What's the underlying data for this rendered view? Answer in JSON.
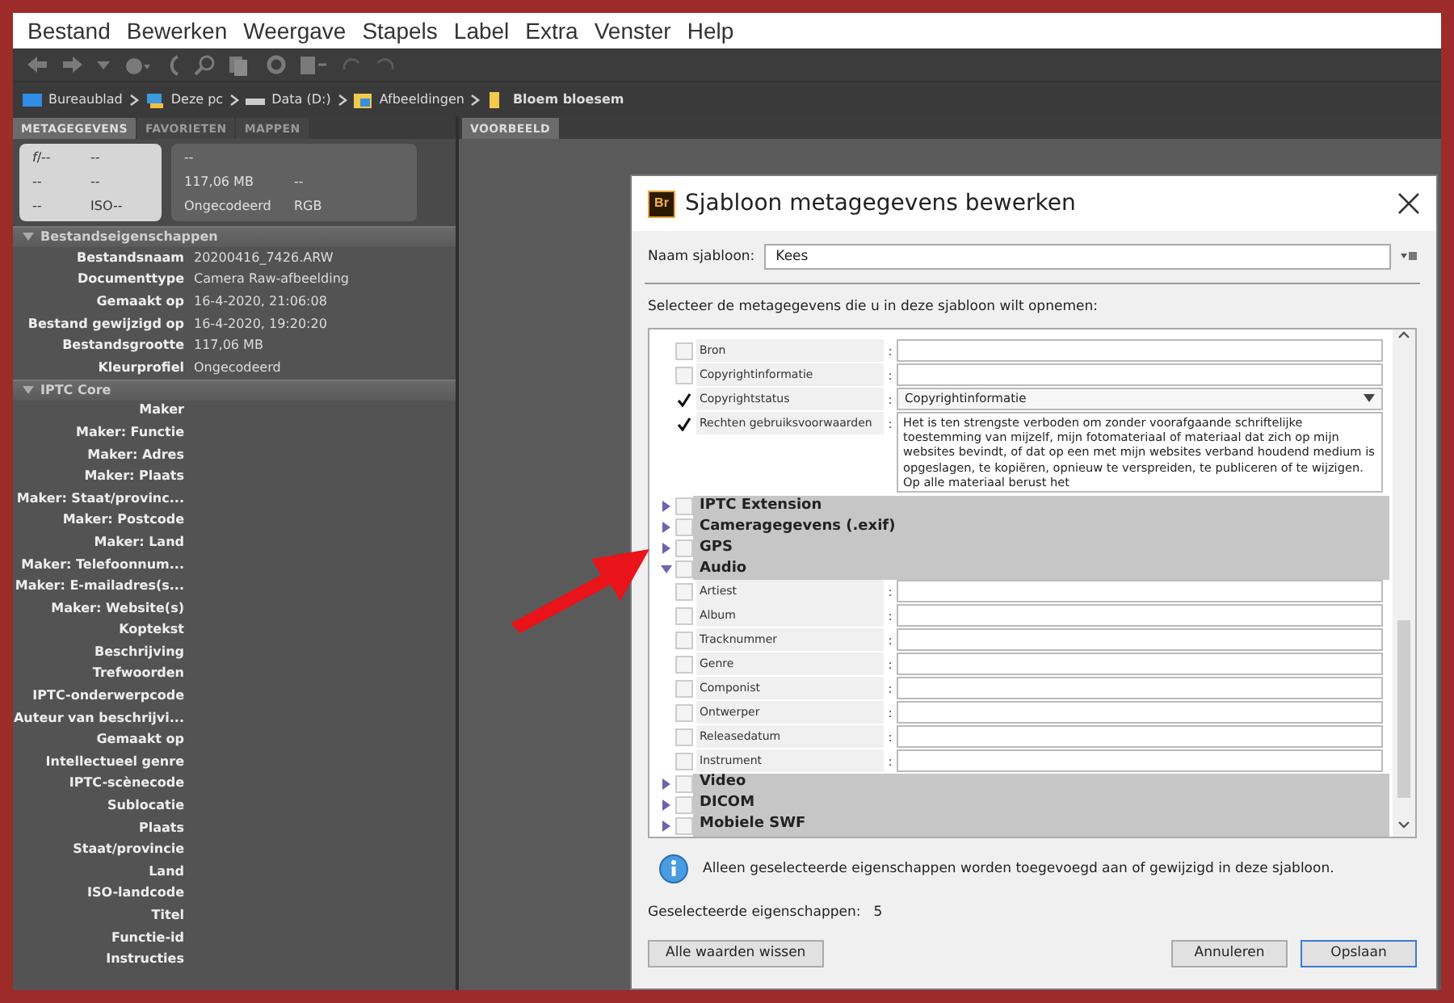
{
  "menu": [
    {
      "label": "Bestand"
    },
    {
      "label": "Bewerken"
    },
    {
      "label": "Weergave"
    },
    {
      "label": "Stapels"
    },
    {
      "label": "Label"
    },
    {
      "label": "Extra"
    },
    {
      "label": "Venster"
    },
    {
      "label": "Help"
    }
  ],
  "breadcrumb": [
    {
      "label": "Bureaublad",
      "kind": "desktop"
    },
    {
      "label": "Deze pc",
      "kind": "pc"
    },
    {
      "label": "Data (D:)",
      "kind": "drive"
    },
    {
      "label": "Afbeeldingen",
      "kind": "pictures"
    },
    {
      "label": "Bloem bloesem",
      "kind": "folder"
    }
  ],
  "panel_tabs": [
    {
      "label": "METAGEGEVENS",
      "selected": true
    },
    {
      "label": "FAVORIETEN",
      "selected": false
    },
    {
      "label": "MAPPEN",
      "selected": false
    }
  ],
  "camera_info": {
    "lens": [
      [
        "*f*/--",
        "--"
      ],
      [
        "--",
        "--"
      ],
      [
        "--",
        "ISO--"
      ]
    ],
    "file": [
      [
        "--"
      ],
      [
        "117,06 MB",
        "--"
      ],
      [
        "Ongecodeerd",
        "RGB"
      ]
    ]
  },
  "file_properties": {
    "title": "Bestandseigenschappen",
    "expanded": true,
    "rows": [
      {
        "label": "Bestandsnaam",
        "value": "20200416_7426.ARW"
      },
      {
        "label": "Documenttype",
        "value": "Camera Raw-afbeelding"
      },
      {
        "label": "Gemaakt op",
        "value": "16-4-2020, 21:06:08"
      },
      {
        "label": "Bestand gewijzigd op",
        "value": "16-4-2020, 19:20:20"
      },
      {
        "label": "Bestandsgrootte",
        "value": "117,06 MB"
      },
      {
        "label": "Kleurprofiel",
        "value": "Ongecodeerd"
      }
    ]
  },
  "iptc_core": {
    "title": "IPTC Core",
    "expanded": true,
    "rows": [
      {
        "label": "Maker"
      },
      {
        "label": "Maker: Functie"
      },
      {
        "label": "Maker: Adres"
      },
      {
        "label": "Maker: Plaats"
      },
      {
        "label": "Maker: Staat/provinc..."
      },
      {
        "label": "Maker: Postcode"
      },
      {
        "label": "Maker: Land"
      },
      {
        "label": "Maker: Telefoonnum..."
      },
      {
        "label": "Maker: E-mailadres(s..."
      },
      {
        "label": "Maker: Website(s)"
      },
      {
        "label": "Koptekst"
      },
      {
        "label": "Beschrijving"
      },
      {
        "label": "Trefwoorden"
      },
      {
        "label": "IPTC-onderwerpcode"
      },
      {
        "label": "Auteur van beschrijvi..."
      },
      {
        "label": "Gemaakt op"
      },
      {
        "label": "Intellectueel genre"
      },
      {
        "label": "IPTC-scènecode"
      },
      {
        "label": "Sublocatie"
      },
      {
        "label": "Plaats"
      },
      {
        "label": "Staat/provincie"
      },
      {
        "label": "Land"
      },
      {
        "label": "ISO-landcode"
      },
      {
        "label": "Titel"
      },
      {
        "label": "Functie-id"
      },
      {
        "label": "Instructies"
      }
    ]
  },
  "preview_tab": {
    "label": "VOORBEELD",
    "selected": true
  },
  "dialog": {
    "title": "Sjabloon metagegevens bewerken",
    "app_icon": "Br",
    "name_label": "Naam sjabloon:",
    "name_value": "Kees",
    "instruction": "Selecteer de metagegevens die u in deze sjabloon wilt opnemen:",
    "items": [
      {
        "kind": "text_field",
        "label": "Bron",
        "separator": ":",
        "checked": false
      },
      {
        "kind": "text_field",
        "label": "Copyrightinformatie",
        "separator": ":",
        "checked": false
      },
      {
        "kind": "dropdown_field",
        "label": "Copyrightstatus",
        "separator": ":",
        "checked": true,
        "value": "Copyrightinformatie"
      },
      {
        "kind": "textarea_field",
        "label": "Rechten gebruiksvoorwaarden",
        "separator": ":",
        "checked": true,
        "value": "Het is ten strengste verboden om zonder voorafgaande schriftelijke toestemming van mijzelf, mijn fotomateriaal of materiaal dat zich op mijn websites bevindt, of dat op een met mijn websites verband houdend medium is opgeslagen, te kopiëren, opnieuw te verspreiden, te publiceren of te wijzigen. Op alle materiaal berust het"
      },
      {
        "kind": "group",
        "label": "IPTC Extension",
        "checked": false,
        "expanded": false
      },
      {
        "kind": "group",
        "label": "Cameragegevens (.exif)",
        "checked": false,
        "expanded": false
      },
      {
        "kind": "group",
        "label": "GPS",
        "checked": false,
        "expanded": false
      },
      {
        "kind": "group",
        "label": "Audio",
        "checked": false,
        "expanded": true,
        "children": [
          {
            "kind": "text_field",
            "label": "Artiest",
            "separator": ":",
            "checked": false
          },
          {
            "kind": "text_field",
            "label": "Album",
            "separator": ":",
            "checked": false
          },
          {
            "kind": "text_field",
            "label": "Tracknummer",
            "separator": ":",
            "checked": false
          },
          {
            "kind": "text_field",
            "label": "Genre",
            "separator": ":",
            "checked": false
          },
          {
            "kind": "text_field",
            "label": "Componist",
            "separator": ":",
            "checked": false
          },
          {
            "kind": "text_field",
            "label": "Ontwerper",
            "separator": ":",
            "checked": false
          },
          {
            "kind": "text_field",
            "label": "Releasedatum",
            "separator": ":",
            "checked": false
          },
          {
            "kind": "text_field",
            "label": "Instrument",
            "separator": ":",
            "checked": false
          }
        ]
      },
      {
        "kind": "group",
        "label": "Video",
        "checked": false,
        "expanded": false
      },
      {
        "kind": "group",
        "label": "DICOM",
        "checked": false,
        "expanded": false
      },
      {
        "kind": "group",
        "label": "Mobiele SWF",
        "checked": false,
        "expanded": false
      }
    ],
    "info_text": "Alleen geselecteerde eigenschappen worden toegevoegd aan of gewijzigd in deze sjabloon.",
    "selected_count_label": "Geselecteerde eigenschappen:",
    "selected_count": "5",
    "buttons": [
      {
        "label": "Alle waarden wissen",
        "kind": "secondary"
      },
      {
        "label": "Annuleren",
        "kind": "secondary"
      },
      {
        "label": "Opslaan",
        "kind": "primary"
      }
    ]
  }
}
